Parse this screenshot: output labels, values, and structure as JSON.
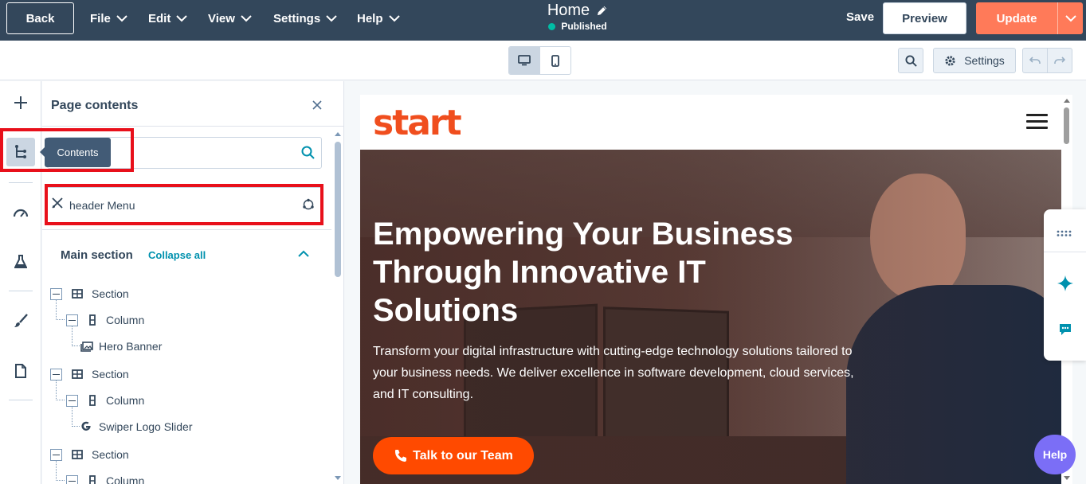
{
  "topbar": {
    "back_label": "Back",
    "menus": [
      {
        "label": "File"
      },
      {
        "label": "Edit"
      },
      {
        "label": "View"
      },
      {
        "label": "Settings"
      },
      {
        "label": "Help"
      }
    ],
    "page_title": "Home",
    "status": "Published",
    "save_label": "Save",
    "preview_label": "Preview",
    "update_label": "Update"
  },
  "toolbar": {
    "settings_label": "Settings"
  },
  "rail": {
    "tooltip": "Contents"
  },
  "panel": {
    "title": "Page contents",
    "search_placeholder": "",
    "global_item": "header Menu",
    "section_heading": "Main section",
    "collapse_all": "Collapse all",
    "tree": [
      {
        "label": "Section"
      },
      {
        "label": "Column"
      },
      {
        "label": "Hero Banner"
      },
      {
        "label": "Section"
      },
      {
        "label": "Column"
      },
      {
        "label": "Swiper Logo Slider"
      },
      {
        "label": "Section"
      },
      {
        "label": "Column"
      }
    ]
  },
  "preview": {
    "logo": "start",
    "hero_title": "Empowering Your Business Through Innovative IT Solutions",
    "hero_text": "Transform your digital infrastructure with cutting-edge technology solutions tailored to your business needs. We deliver excellence in software development, cloud services, and IT consulting.",
    "cta_label": "Talk to our Team"
  },
  "help_label": "Help",
  "colors": {
    "topbar": "#33475b",
    "accent_update": "#ff7a59",
    "link": "#0091ae",
    "highlight": "#e8101b",
    "brand_orange": "#f04e1e",
    "cta_orange": "#ff4a00",
    "help_purple": "#7b6ef6",
    "published_dot": "#00bda5"
  }
}
